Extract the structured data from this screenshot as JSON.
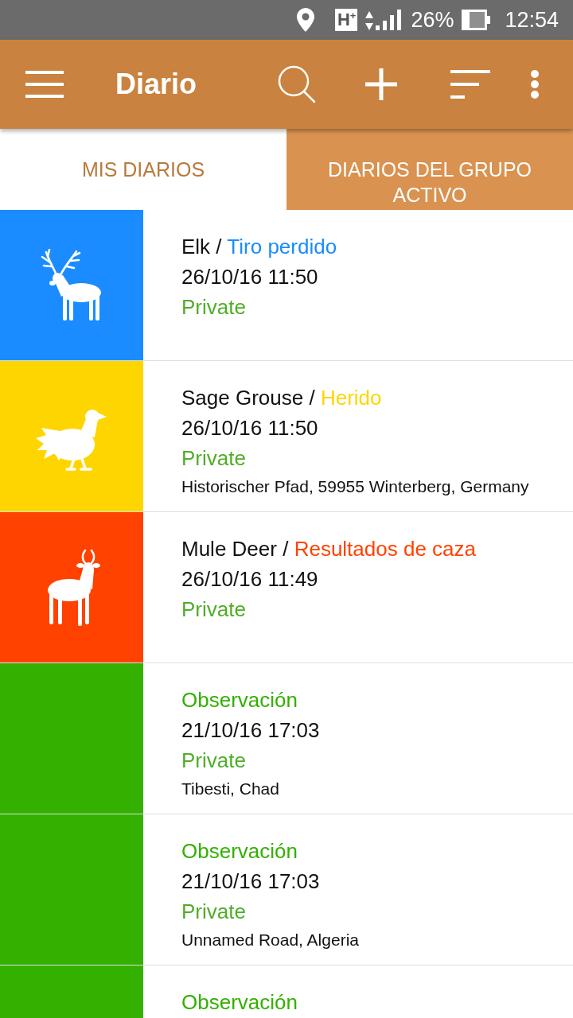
{
  "status_bar": {
    "network": "H$^{+}$",
    "battery": "26%",
    "time": "12:54"
  },
  "app_bar": {
    "title": "Diario"
  },
  "tabs": [
    {
      "label": "MIS DIARIOS",
      "selected": true
    },
    {
      "label": "DIARIOS DEL GRUPO ACTIVO",
      "selected": false
    }
  ],
  "entries": [
    {
      "kind": "elk",
      "color": "#1a8cff",
      "animal": "Elk",
      "separator": "/",
      "type": "Tiro perdido",
      "datetime": "26/10/16 11:50",
      "visibility": "Private"
    },
    {
      "kind": "grouse",
      "color": "#ffd500",
      "animal": "Sage Grouse",
      "separator": "/",
      "type": "Herido",
      "datetime": "26/10/16 11:50",
      "visibility": "Private",
      "location": "Historischer Pfad, 59955 Winterberg, Germany"
    },
    {
      "kind": "deer",
      "color": "#ff4200",
      "animal": "Mule Deer",
      "separator": "/",
      "type": "Resultados de caza",
      "datetime": "26/10/16 11:49",
      "visibility": "Private"
    },
    {
      "kind": "observation",
      "color": "#33b000",
      "type": "Observación",
      "datetime": "21/10/16 17:03",
      "visibility": "Private",
      "location": "Tibesti, Chad"
    },
    {
      "kind": "observation",
      "color": "#33b000",
      "type": "Observación",
      "datetime": "21/10/16 17:03",
      "visibility": "Private",
      "location": "Unnamed Road, Algeria"
    },
    {
      "kind": "observation",
      "color": "#33b000",
      "type": "Observación"
    }
  ]
}
